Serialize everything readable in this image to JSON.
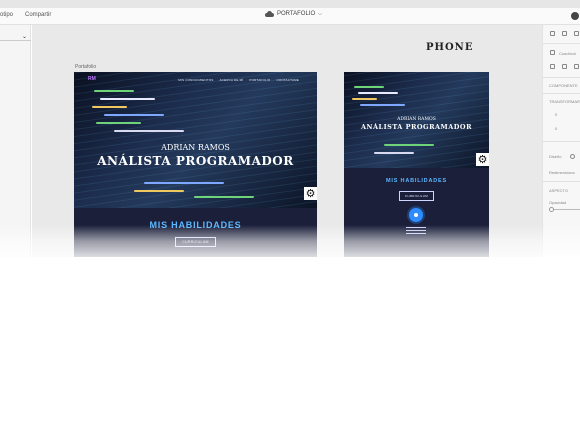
{
  "menubar": {
    "items": [
      {
        "label": "otipo"
      },
      {
        "label": "Compartir"
      }
    ],
    "document_title": "PORTAFOLIO",
    "icons": [
      "cloud-icon",
      "chevron-down-icon",
      "user-icon"
    ]
  },
  "canvas": {
    "phone_label": "PHONE",
    "artboard_label": "Portafolio"
  },
  "desktop": {
    "logo": "RM",
    "nav": [
      "MIS CONOCIMIENTOS",
      "ACERCA DE MÍ",
      "PORTAFOLIO",
      "CONTACTAME"
    ],
    "hero_name": "ADRIAN RAMOS",
    "hero_title": "ANÁLISTA PROGRAMADOR",
    "section_title": "MIS HABILIDADES",
    "button": "CURRICULUM"
  },
  "phone": {
    "hero_name": "ADRIAN RAMOS",
    "hero_title": "ANÁLISTA PROGRAMADOR",
    "section_title": "MIS HABILIDADES",
    "button": "CURRICULUM"
  },
  "rightpanel": {
    "row_cuadricula": "Cuadrícul",
    "componente": "COMPONENTE",
    "transformar": "TRANSFORMAR",
    "w_value": "0",
    "h_value": "0",
    "diseno": "Diseño",
    "redimensionar": "Redimensiona",
    "aspecto": "ASPECTO",
    "opacidad": "Opacidad",
    "icons": [
      "align-icon",
      "distribute-icon",
      "grid-icon",
      "info-icon"
    ]
  },
  "colors": {
    "accent_blue": "#5bb7ff",
    "artboard_bg": "#1b1f3a",
    "canvas_bg": "#e9e9e9"
  }
}
